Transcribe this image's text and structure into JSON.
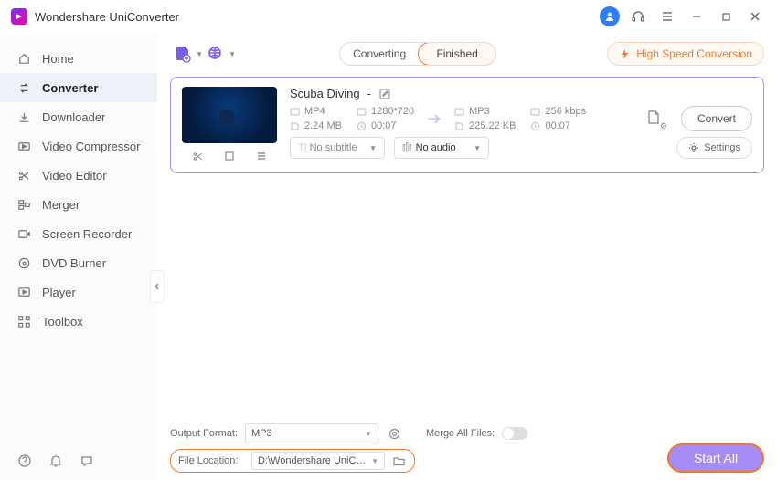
{
  "app": {
    "title": "Wondershare UniConverter"
  },
  "sidebar": {
    "items": [
      {
        "label": "Home"
      },
      {
        "label": "Converter"
      },
      {
        "label": "Downloader"
      },
      {
        "label": "Video Compressor"
      },
      {
        "label": "Video Editor"
      },
      {
        "label": "Merger"
      },
      {
        "label": "Screen Recorder"
      },
      {
        "label": "DVD Burner"
      },
      {
        "label": "Player"
      },
      {
        "label": "Toolbox"
      }
    ]
  },
  "tabs": {
    "converting": "Converting",
    "finished": "Finished"
  },
  "hispeed": "High Speed Conversion",
  "file": {
    "title": "Scuba Diving",
    "dash": " - ",
    "in_format": "MP4",
    "in_res": "1280*720",
    "in_size": "2.24 MB",
    "in_dur": "00:07",
    "out_format": "MP3",
    "out_bitrate": "256 kbps",
    "out_size": "225.22 KB",
    "out_dur": "00:07",
    "subtitle": "No subtitle",
    "audio": "No audio",
    "settings": "Settings",
    "convert": "Convert"
  },
  "footer": {
    "output_label": "Output Format:",
    "output_value": "MP3",
    "merge_label": "Merge All Files:",
    "loc_label": "File Location:",
    "loc_value": "D:\\Wondershare UniConvert",
    "start": "Start All"
  }
}
